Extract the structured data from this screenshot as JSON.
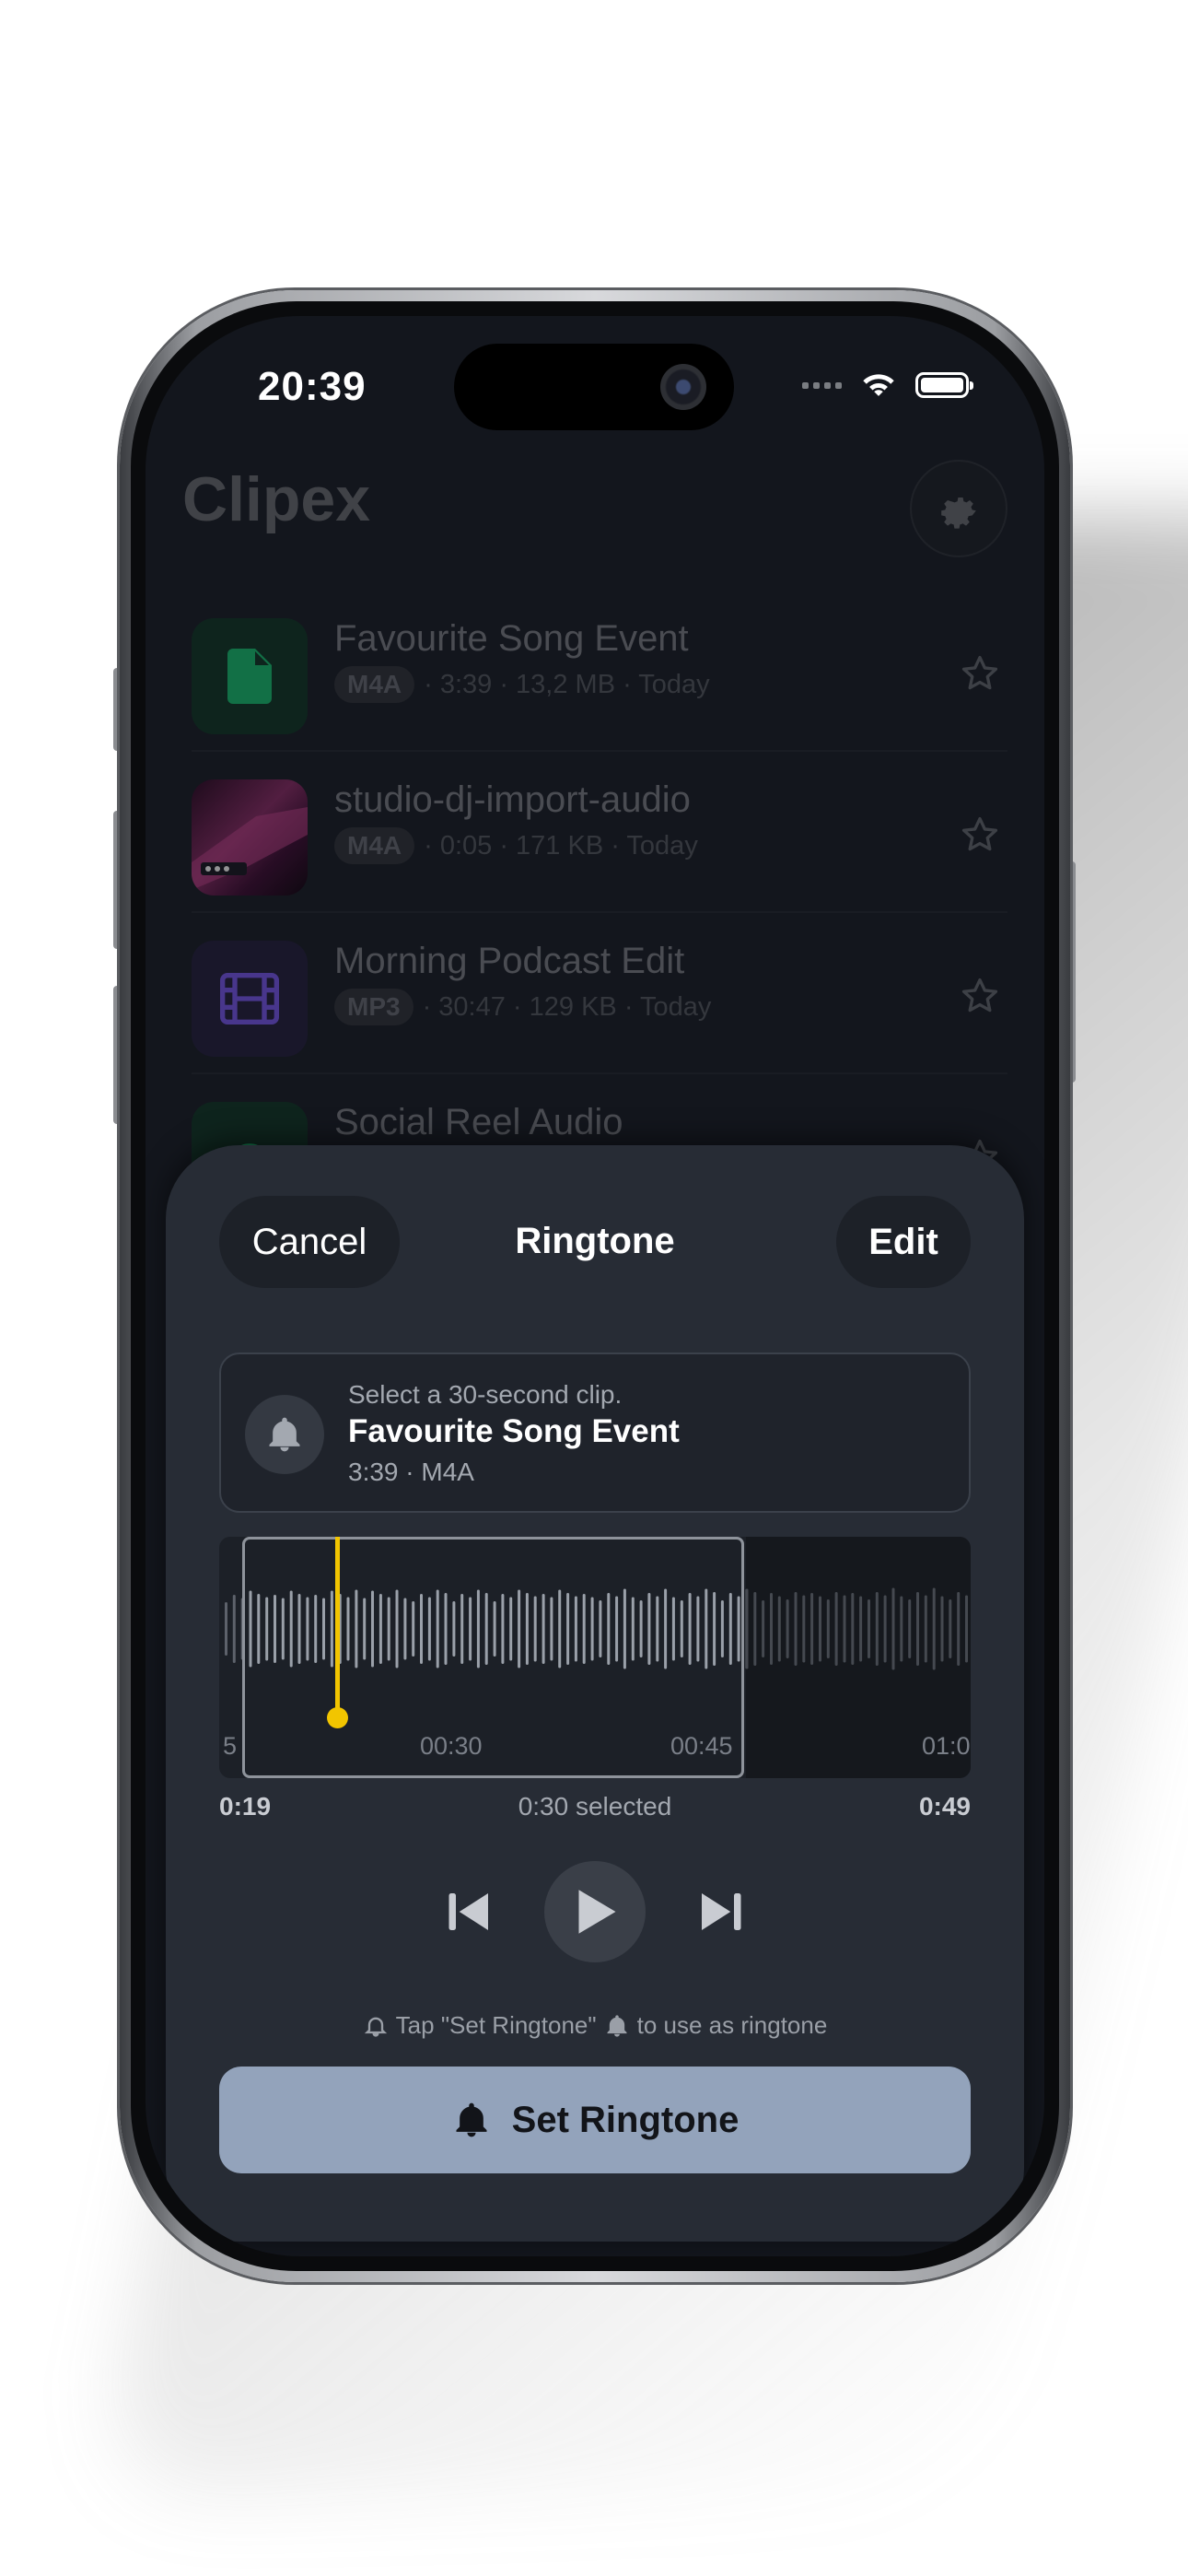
{
  "status": {
    "time": "20:39"
  },
  "app": {
    "title": "Clipex",
    "files": [
      {
        "name": "Favourite Song Event",
        "format": "M4A",
        "meta": "· 3:39 · 13,2 MB · Today",
        "thumb": "document-icon",
        "thumb_color": "#17a865"
      },
      {
        "name": "studio-dj-import-audio",
        "format": "M4A",
        "meta": "· 0:05 · 171 KB · Today",
        "thumb": "photo-thumbnail",
        "thumb_color": "#7a2a5c"
      },
      {
        "name": "Morning Podcast Edit",
        "format": "MP3",
        "meta": "· 30:47 · 129 KB · Today",
        "thumb": "film-icon",
        "thumb_color": "#6a4fd0"
      },
      {
        "name": "Social Reel Audio",
        "format": "",
        "meta": "",
        "thumb": "audio-icon",
        "thumb_color": "#17a865"
      }
    ]
  },
  "sheet": {
    "cancel_label": "Cancel",
    "title": "Ringtone",
    "edit_label": "Edit",
    "info": {
      "hint": "Select a 30-second clip.",
      "title": "Favourite Song Event",
      "meta": "3:39 · M4A"
    },
    "waveform": {
      "tick_left": "5",
      "tick_1": "00:30",
      "tick_2": "00:45",
      "tick_right": "01:0"
    },
    "range": {
      "start": "0:19",
      "selected": "0:30 selected",
      "end": "0:49"
    },
    "tip": {
      "before": "Tap \"Set Ringtone\"",
      "after": "to use as ringtone"
    },
    "set_button_label": "Set Ringtone"
  },
  "colors": {
    "accent_playhead": "#f2c500",
    "set_button": "#93a3bb",
    "sheet_bg": "#272c35"
  }
}
